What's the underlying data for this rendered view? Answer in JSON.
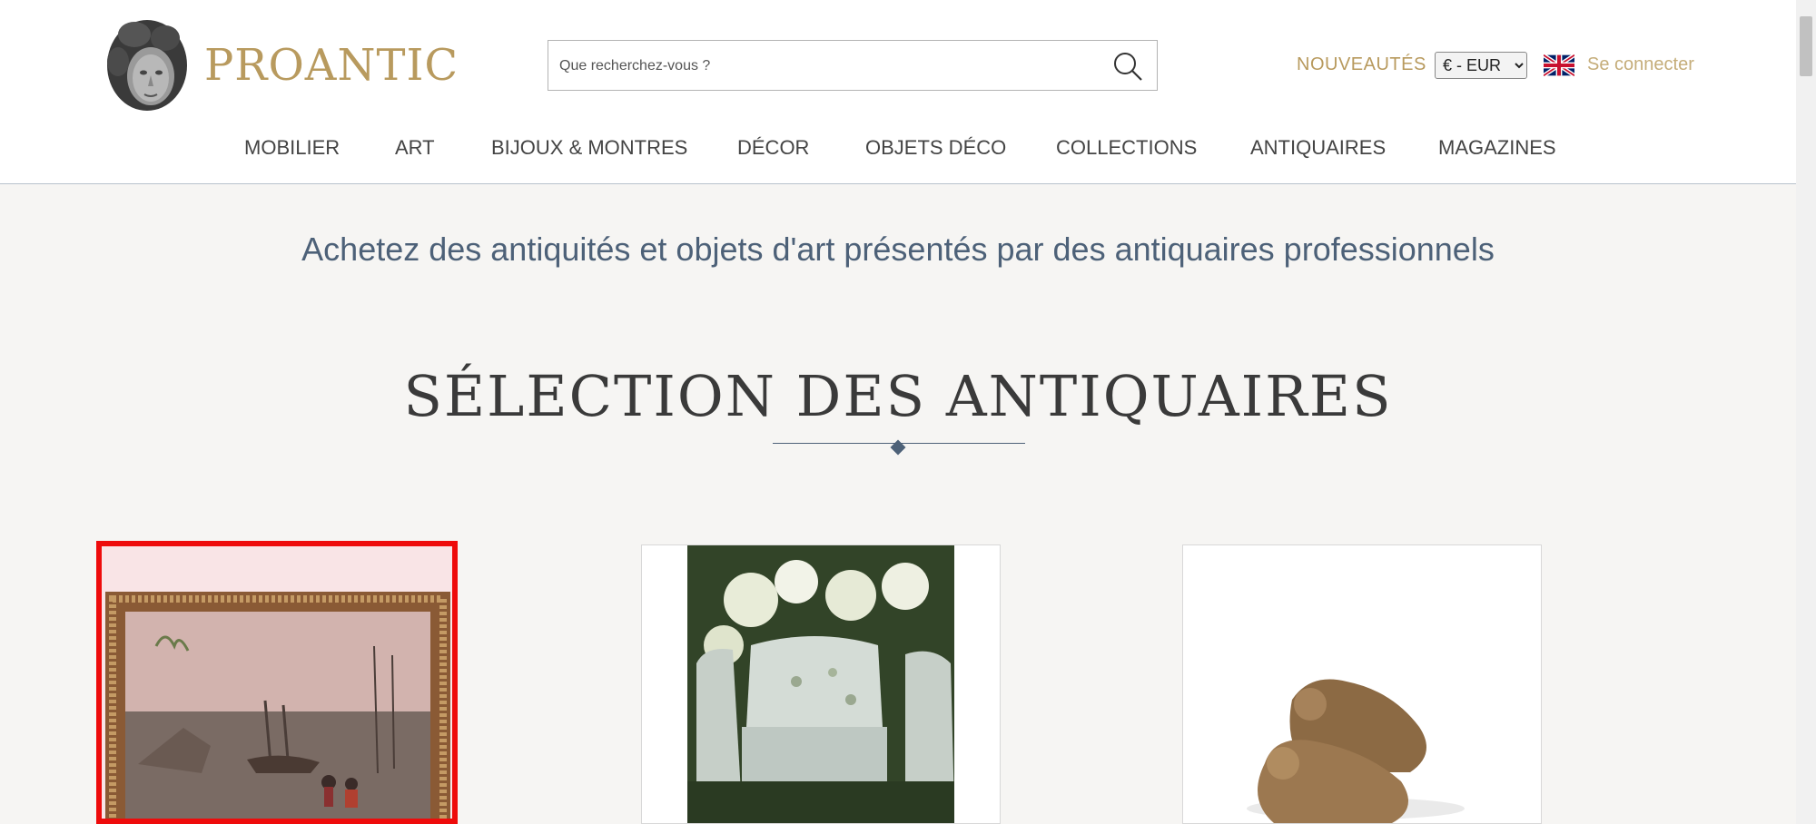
{
  "header": {
    "brand": "PROANTIC",
    "search_placeholder": "Que recherchez-vous ?",
    "nouveautes": "NOUVEAUTÉS",
    "currency_selected": "€ - EUR",
    "login": "Se connecter"
  },
  "nav": [
    "MOBILIER",
    "ART",
    "BIJOUX & MONTRES",
    "DÉCOR",
    "OBJETS DÉCO",
    "COLLECTIONS",
    "ANTIQUAIRES",
    "MAGAZINES"
  ],
  "main": {
    "tagline": "Achetez des antiquités et objets d'art présentés par des antiquaires professionnels",
    "section_title": "SÉLECTION DES ANTIQUAIRES"
  },
  "colors": {
    "accent_gold": "#b89a5e",
    "heading_blue": "#4d6178",
    "selected_outline": "#ee0b0b"
  }
}
